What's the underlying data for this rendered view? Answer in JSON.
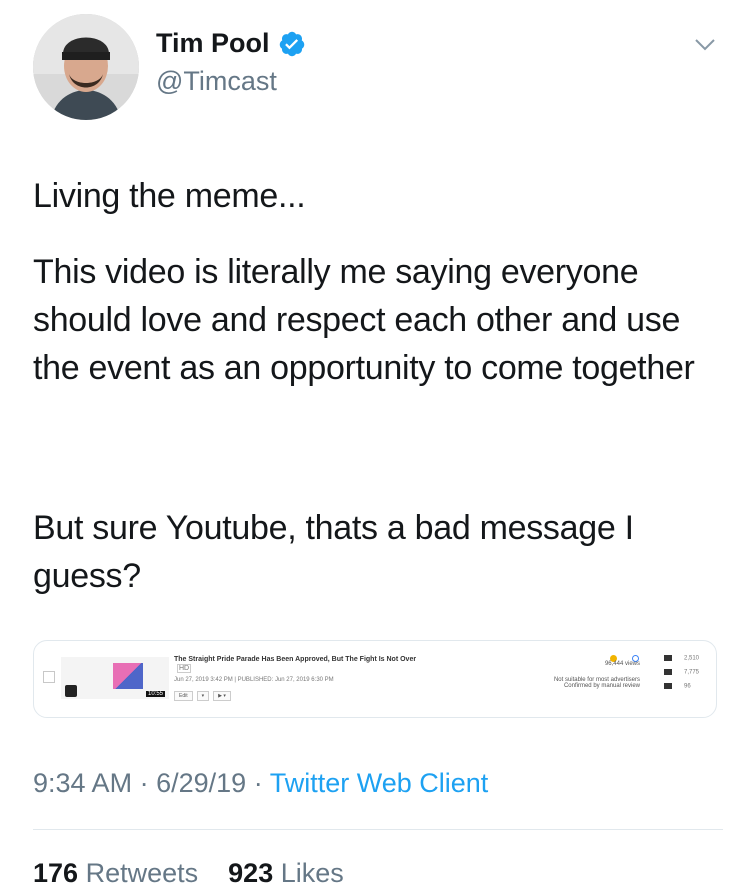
{
  "user": {
    "name": "Tim Pool",
    "handle": "@Timcast"
  },
  "tweet": {
    "paragraphs": [
      "Living the meme...",
      "This video is literally me saying everyone should love and respect each other and use the event as an opportunity to come together",
      "But sure Youtube, thats a bad message I guess?"
    ]
  },
  "embed": {
    "video_title": "The Straight Pride Parade Has Been Approved, But The Fight Is Not Over",
    "badge": "HD",
    "dates": "Jun 27, 2019 3:42 PM | PUBLISHED: Jun 27, 2019 6:30 PM",
    "duration": "10:55",
    "edit_label": "Edit",
    "views": "96,444 views",
    "status_line1": "Not suitable for most advertisers",
    "status_line2": "Confirmed by manual review",
    "comments": "2,510",
    "likes": "7,775",
    "dislikes": "96"
  },
  "meta": {
    "time": "9:34 AM",
    "date": "6/29/19",
    "separator": "·",
    "client": "Twitter Web Client"
  },
  "stats": {
    "retweets_count": "176",
    "retweets_label": "Retweets",
    "likes_count": "923",
    "likes_label": "Likes"
  },
  "colors": {
    "link_blue": "#1da1f2",
    "verified_blue": "#1da1f2",
    "muted_gray": "#657786"
  },
  "icons": {
    "verified": "verified-badge-icon",
    "chevron": "chevron-down-icon"
  }
}
